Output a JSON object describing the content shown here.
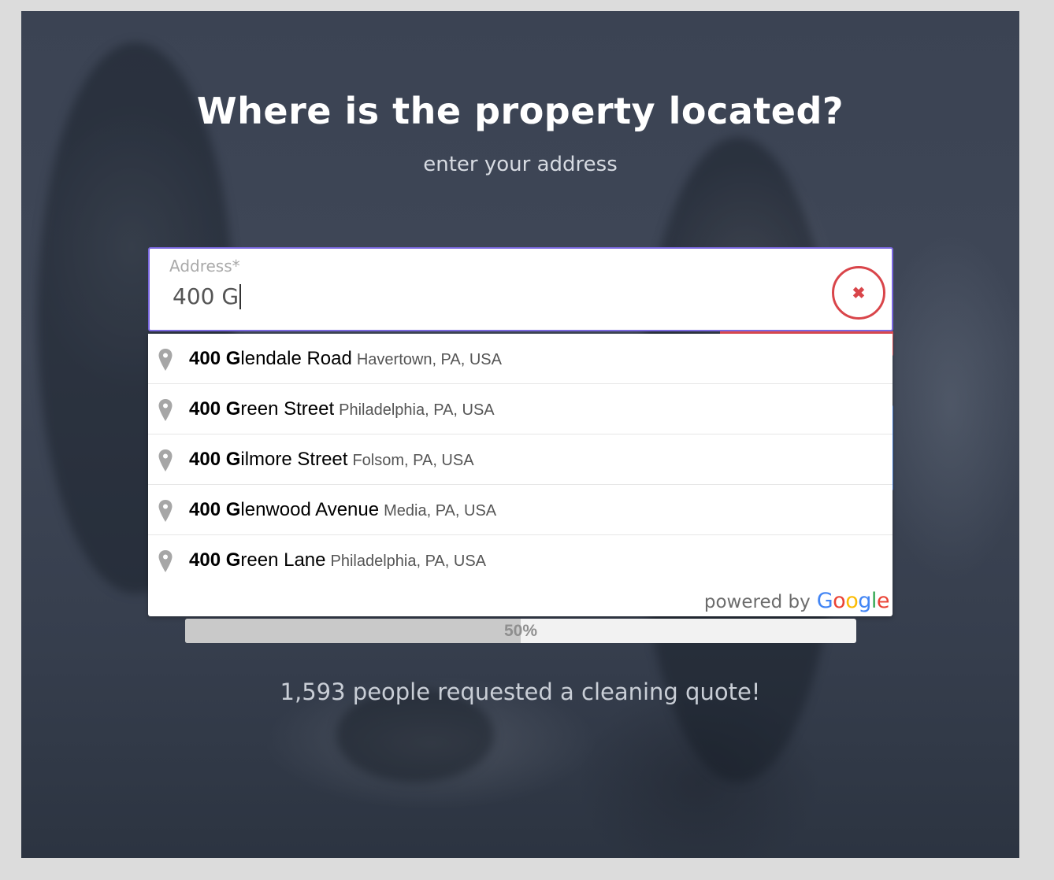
{
  "heading": {
    "title": "Where is the property located?",
    "subtitle": "enter your address"
  },
  "address_field": {
    "label": "Address*",
    "value": "400 G",
    "clear_icon": "close-icon"
  },
  "suggestions": [
    {
      "match": "400 G",
      "rest": "lendale Road",
      "secondary": "Havertown, PA, USA",
      "icon": "map-pin-icon"
    },
    {
      "match": "400 G",
      "rest": "reen Street",
      "secondary": "Philadelphia, PA, USA",
      "icon": "map-pin-icon"
    },
    {
      "match": "400 G",
      "rest": "ilmore Street",
      "secondary": "Folsom, PA, USA",
      "icon": "map-pin-icon"
    },
    {
      "match": "400 G",
      "rest": "lenwood Avenue",
      "secondary": "Media, PA, USA",
      "icon": "map-pin-icon"
    },
    {
      "match": "400 G",
      "rest": "reen Lane",
      "secondary": "Philadelphia, PA, USA",
      "icon": "map-pin-icon"
    }
  ],
  "attribution": {
    "prefix": "powered by",
    "brand": "Google"
  },
  "progress": {
    "value": 0.5,
    "label": "50%"
  },
  "footer": {
    "requests_text": "1,593 people requested a cleaning quote!"
  },
  "colors": {
    "input_border": "#7a68e0",
    "clear_button": "#d9454a",
    "page_background": "#dcdcdc"
  }
}
